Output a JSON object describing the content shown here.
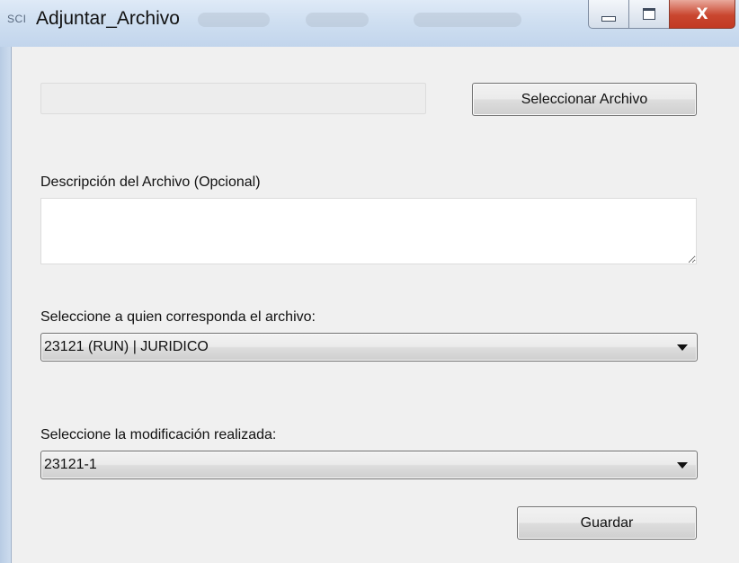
{
  "window": {
    "title": "Adjuntar_Archivo",
    "icon_text": "SCI",
    "buttons": {
      "minimize": "minimize-icon",
      "maximize": "maximize-icon",
      "close": "close-icon"
    },
    "close_glyph": "X"
  },
  "file": {
    "path_value": "",
    "select_button_label": "Seleccionar Archivo"
  },
  "description": {
    "label": "Descripción del Archivo (Opcional)",
    "value": ""
  },
  "assignee": {
    "label": "Seleccione a quien corresponda el archivo:",
    "selected": "23121 (RUN) | JURIDICO"
  },
  "modification": {
    "label": "Seleccione la modificación realizada:",
    "selected": "23121-1"
  },
  "actions": {
    "save_label": "Guardar"
  },
  "colors": {
    "title_bar": "#cfdff1",
    "close_button": "#c9462f",
    "window_background": "#f0f0f0"
  }
}
